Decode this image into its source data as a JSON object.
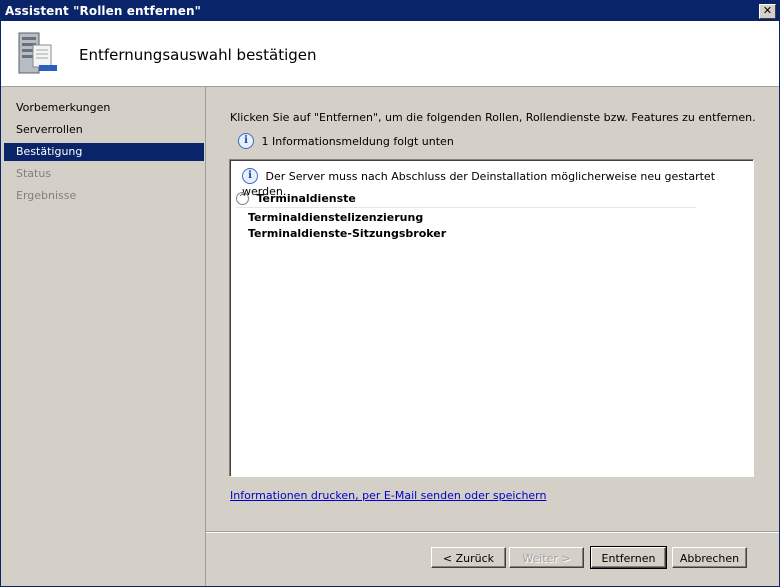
{
  "window": {
    "title": "Assistent \"Rollen entfernen\"",
    "close_glyph": "✕"
  },
  "header": {
    "title": "Entfernungsauswahl bestätigen",
    "icon": "server-roles-icon"
  },
  "nav": {
    "items": [
      {
        "label": "Vorbemerkungen",
        "state": "normal"
      },
      {
        "label": "Serverrollen",
        "state": "normal"
      },
      {
        "label": "Bestätigung",
        "state": "active"
      },
      {
        "label": "Status",
        "state": "disabled"
      },
      {
        "label": "Ergebnisse",
        "state": "disabled"
      }
    ]
  },
  "content": {
    "intro": "Klicken Sie auf \"Entfernen\", um die folgenden Rollen, Rollendienste bzw. Features zu entfernen.",
    "info_count": "1 Informationsmeldung folgt unten",
    "info_glyph": "i",
    "warning": "Der Server muss nach Abschluss der Deinstallation möglicherweise neu gestartet werden.",
    "section": {
      "title": "Terminaldienste",
      "collapse_glyph": "^",
      "items": [
        "Terminaldienstelizenzierung",
        "Terminaldienste-Sitzungsbroker"
      ]
    },
    "link": "Informationen drucken, per E-Mail senden oder speichern"
  },
  "buttons": {
    "back": "< Zurück",
    "next": "Weiter >",
    "remove": "Entfernen",
    "cancel": "Abbrechen"
  }
}
